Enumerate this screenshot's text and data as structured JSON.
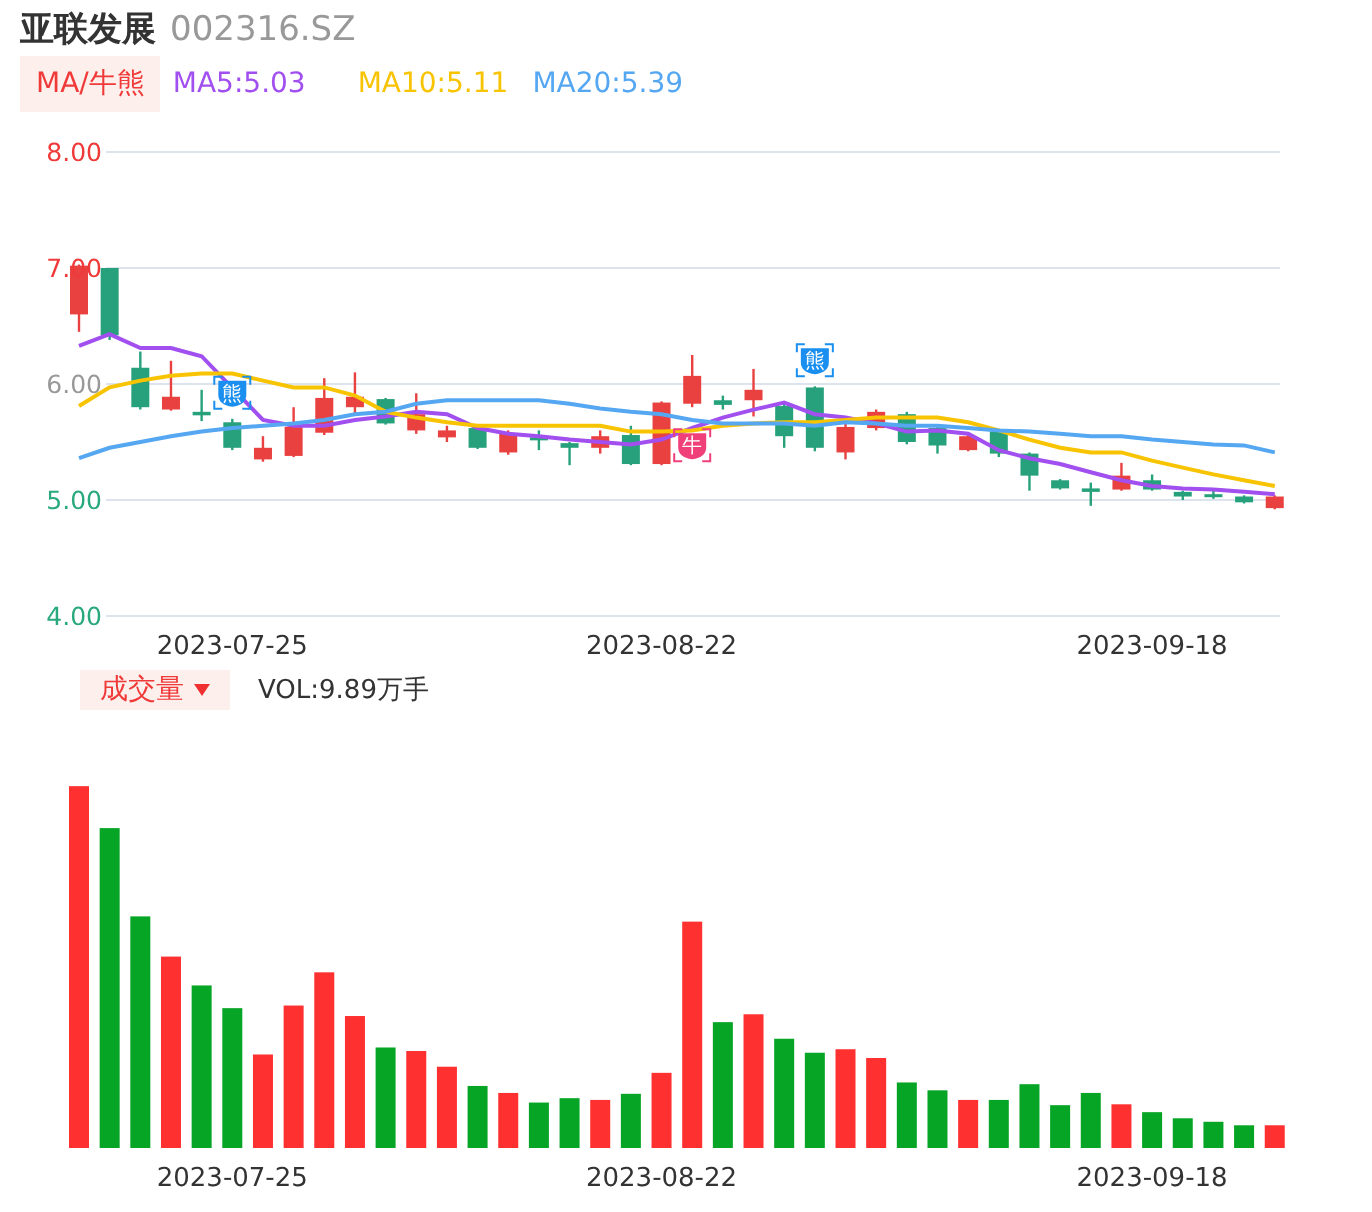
{
  "stock": {
    "name": "亚联发展",
    "code": "002316.SZ"
  },
  "price": {
    "indicator": "MA/牛熊",
    "chart_data": {
      "type": "candlestick",
      "grid": true,
      "ylim": [
        4,
        8
      ],
      "categories": [
        null,
        null,
        null,
        null,
        null,
        "2023-07-25",
        null,
        null,
        null,
        null,
        null,
        null,
        null,
        null,
        null,
        null,
        null,
        null,
        null,
        "2023-08-22",
        null,
        null,
        null,
        null,
        null,
        null,
        null,
        null,
        null,
        null,
        null,
        null,
        null,
        null,
        null,
        "2023-09-18",
        null,
        null,
        null,
        null
      ],
      "yticks": [
        {
          "value": 8,
          "label": "8.00"
        },
        {
          "value": 7,
          "label": "7.00"
        },
        {
          "value": 6,
          "label": "6.00"
        },
        {
          "value": 5,
          "label": "5.00"
        },
        {
          "value": 4,
          "label": "4.00"
        }
      ],
      "series": [
        {
          "name": "MA5:5.03",
          "type": "line",
          "color": "#a24ff0",
          "values": [
            6.33,
            6.43,
            6.31,
            6.31,
            6.24,
            null,
            5.69,
            5.64,
            5.64,
            5.69,
            5.72,
            5.76,
            5.74,
            5.62,
            5.57,
            5.55,
            5.52,
            5.5,
            5.48,
            5.52,
            5.62,
            5.71,
            5.78,
            5.84,
            5.74,
            5.71,
            5.66,
            5.59,
            5.6,
            5.57,
            5.43,
            5.36,
            5.31,
            5.24,
            5.17,
            5.12,
            5.1,
            5.09,
            5.07,
            5.05
          ]
        },
        {
          "name": "MA10:5.11",
          "type": "line",
          "color": "#f8c300",
          "values": [
            5.81,
            5.97,
            6.03,
            6.07,
            6.09,
            6.09,
            6.03,
            5.97,
            5.97,
            5.9,
            5.76,
            5.71,
            5.67,
            5.64,
            5.64,
            5.64,
            5.64,
            5.64,
            5.59,
            5.59,
            5.6,
            5.64,
            5.66,
            5.67,
            5.67,
            5.69,
            5.71,
            5.71,
            5.71,
            5.67,
            5.6,
            5.52,
            5.45,
            5.41,
            5.41,
            5.34,
            5.28,
            5.22,
            5.17,
            5.12
          ]
        },
        {
          "name": "MA20:5.39",
          "type": "line",
          "color": "#55a7f2",
          "values": [
            5.36,
            5.45,
            5.5,
            5.55,
            5.59,
            5.62,
            5.64,
            5.66,
            5.69,
            5.74,
            5.76,
            5.83,
            5.86,
            5.86,
            5.86,
            5.86,
            5.83,
            5.79,
            5.76,
            5.74,
            5.69,
            5.66,
            5.66,
            5.66,
            5.64,
            5.67,
            5.66,
            5.64,
            5.64,
            5.62,
            5.6,
            5.59,
            5.57,
            5.55,
            5.55,
            5.52,
            5.5,
            5.48,
            5.47,
            5.41
          ]
        }
      ],
      "ohlc": [
        [
          6.6,
          7.03,
          6.45,
          7.02
        ],
        [
          7.0,
          7.0,
          6.38,
          6.42
        ],
        [
          6.14,
          6.28,
          5.78,
          5.8
        ],
        [
          5.78,
          6.2,
          5.77,
          5.89
        ],
        [
          5.76,
          5.95,
          5.68,
          5.73
        ],
        [
          5.67,
          5.7,
          5.43,
          5.45
        ],
        [
          5.35,
          5.55,
          5.33,
          5.45
        ],
        [
          5.38,
          5.8,
          5.37,
          5.63
        ],
        [
          5.58,
          6.05,
          5.56,
          5.88
        ],
        [
          5.8,
          6.1,
          5.75,
          5.89
        ],
        [
          5.87,
          5.88,
          5.65,
          5.66
        ],
        [
          5.6,
          5.92,
          5.57,
          5.74
        ],
        [
          5.54,
          5.64,
          5.5,
          5.6
        ],
        [
          5.62,
          5.64,
          5.44,
          5.45
        ],
        [
          5.41,
          5.6,
          5.39,
          5.57
        ],
        [
          5.54,
          5.6,
          5.43,
          5.52
        ],
        [
          5.49,
          5.5,
          5.3,
          5.45
        ],
        [
          5.45,
          5.6,
          5.4,
          5.55
        ],
        [
          5.56,
          5.64,
          5.3,
          5.31
        ],
        [
          5.31,
          5.85,
          5.3,
          5.84
        ],
        [
          5.83,
          6.25,
          5.8,
          6.07
        ],
        [
          5.86,
          5.9,
          5.78,
          5.82
        ],
        [
          5.86,
          6.13,
          5.72,
          5.95
        ],
        [
          5.81,
          5.84,
          5.45,
          5.55
        ],
        [
          5.97,
          5.98,
          5.42,
          5.45
        ],
        [
          5.41,
          5.7,
          5.35,
          5.63
        ],
        [
          5.62,
          5.78,
          5.6,
          5.76
        ],
        [
          5.74,
          5.76,
          5.48,
          5.5
        ],
        [
          5.62,
          5.64,
          5.4,
          5.47
        ],
        [
          5.43,
          5.57,
          5.42,
          5.55
        ],
        [
          5.59,
          5.6,
          5.37,
          5.4
        ],
        [
          5.4,
          5.41,
          5.08,
          5.21
        ],
        [
          5.17,
          5.18,
          5.09,
          5.1
        ],
        [
          5.1,
          5.15,
          4.95,
          5.07
        ],
        [
          5.09,
          5.32,
          5.08,
          5.21
        ],
        [
          5.17,
          5.22,
          5.08,
          5.09
        ],
        [
          5.07,
          5.08,
          5.0,
          5.03
        ],
        [
          5.05,
          5.08,
          5.01,
          5.03
        ],
        [
          5.03,
          5.04,
          4.97,
          4.98
        ],
        [
          4.93,
          5.04,
          4.92,
          5.03
        ]
      ]
    },
    "badges": [
      {
        "kind": "bear",
        "label": "熊"
      },
      {
        "kind": "bull",
        "label": "牛"
      },
      {
        "kind": "bear",
        "label": "熊"
      }
    ]
  },
  "volume": {
    "indicator": "成交量",
    "reading": "VOL:9.89万手",
    "xticks": [
      "2023-07-25",
      "2023-08-22",
      "2023-09-18"
    ]
  }
}
